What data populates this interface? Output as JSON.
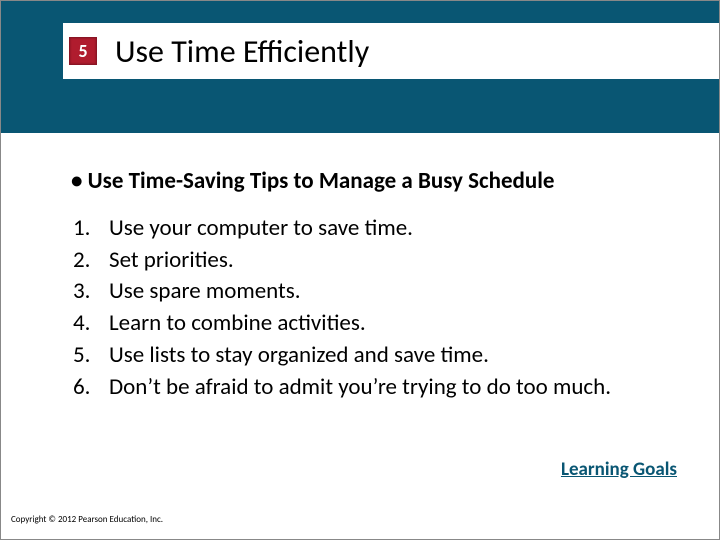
{
  "chapter_number": "5",
  "title": "Use Time Efficiently",
  "subtitle": "• Use Time-Saving Tips to Manage a Busy Schedule",
  "list_items": [
    {
      "n": "1.",
      "text": "Use your computer to save time."
    },
    {
      "n": "2.",
      "text": "Set priorities."
    },
    {
      "n": "3.",
      "text": "Use spare moments."
    },
    {
      "n": "4.",
      "text": "Learn to combine activities."
    },
    {
      "n": "5.",
      "text": "Use lists to stay organized and save time."
    },
    {
      "n": "6.",
      "text": "Don’t be afraid to admit you’re trying to do too much."
    }
  ],
  "learning_goals_label": "Learning Goals",
  "copyright": "Copyright © 2012 Pearson Education, Inc."
}
